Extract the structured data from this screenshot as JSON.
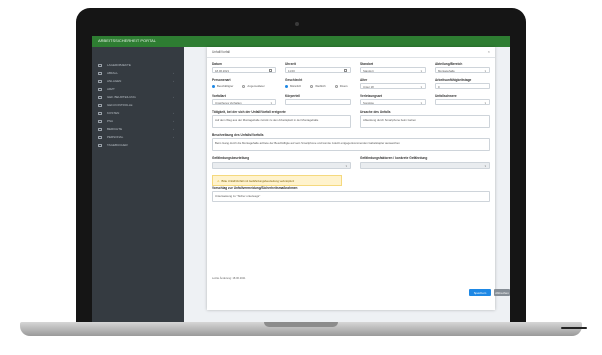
{
  "app": {
    "brand": "ARBEITSSICHERHEIT PORTAL"
  },
  "sidebar": {
    "items": [
      {
        "label": "LAGEROBJEKTE",
        "icon": "box-icon",
        "has_children": false
      },
      {
        "label": "ABFALL",
        "icon": "trash-icon",
        "has_children": true
      },
      {
        "label": "ANLAGEN",
        "icon": "gear-icon",
        "has_children": true
      },
      {
        "label": "ARZT",
        "icon": "medical-icon",
        "has_children": false
      },
      {
        "label": "GEF. BEURTEILUNG",
        "icon": "clipboard-icon",
        "has_children": true
      },
      {
        "label": "GEN.KONTROLLE",
        "icon": "check-icon",
        "has_children": false
      },
      {
        "label": "KOSTEN",
        "icon": "euro-icon",
        "has_children": true
      },
      {
        "label": "PSA",
        "icon": "helmet-icon",
        "has_children": true
      },
      {
        "label": "BERICHTE",
        "icon": "report-icon",
        "has_children": true
      },
      {
        "label": "PERSONAL",
        "icon": "users-icon",
        "has_children": true
      },
      {
        "label": "TAGEBUCHER",
        "icon": "book-icon",
        "has_children": false
      }
    ]
  },
  "modal": {
    "title": "Unfall/Vorfall",
    "close_label": "×",
    "datum": {
      "label": "Datum",
      "value": "18.06.2021"
    },
    "uhrzeit": {
      "label": "Uhrzeit",
      "value": "11:00"
    },
    "standort": {
      "label": "Standort",
      "value": "Standort"
    },
    "abteilung": {
      "label": "Abteilung/Bereich",
      "value": "Montagehalle"
    },
    "personenart": {
      "label": "Personenart",
      "options": [
        "Beschäftigter",
        "Angemeldeter"
      ],
      "selected": "Beschäftigter"
    },
    "geschlecht": {
      "label": "Geschlecht",
      "options": [
        "Männlich",
        "Weiblich",
        "Divers"
      ],
      "selected": "Männlich"
    },
    "alter": {
      "label": "Alter",
      "value": "Unter 18"
    },
    "arbeitsunfaehigkeitstage": {
      "label": "Arbeitsunfähigkeitstage",
      "value": "0"
    },
    "vorfallart": {
      "label": "Vorfallart",
      "value": "Unsicheres Verhalten"
    },
    "koerperteil": {
      "label": "Körperteil",
      "value": ""
    },
    "verletzungsart": {
      "label": "Verletzungsart",
      "value": "Sonstige"
    },
    "unfallschwere": {
      "label": "Unfallschwere",
      "value": ""
    },
    "taetigkeit": {
      "label": "Tätigkeit, bei der sich der Unfall/Vorfall ereignete",
      "value": "Auf dem Weg aus der Montagehalle zurück zu den Arbeitsplatz in der Montagehalle"
    },
    "ursache": {
      "label": "Ursache des Unfalls",
      "value": "Ablenkung durch Smartphone beim Gehen"
    },
    "beschreibung": {
      "label": "Beschreibung des Unfalls/Vorfalls",
      "value": "Beim Gang durch die Montagehalle achtete der Beschäftigte auf sein Smartphone und konnte zuletzt entgegenkommenden Gabelstapler ausweichen"
    },
    "gefaehrdungsbeurteilung": {
      "label": "Gefährdungsbeurteilung",
      "value": "",
      "warning": "Bitte Unfall/Vorfall mit Gefährdungsbeurteilung verknüpfen!"
    },
    "gefaehrdungsfaktoren": {
      "label": "Gefährdungsfaktoren / konkrete Gefährdung",
      "value": ""
    },
    "vorschlag": {
      "label": "Vorschlag zur Unfallvermeidung/Sicherheitsmaßnahmen",
      "value": "Unterweisung zu \"Sicher unterwegs\""
    },
    "erfasst": "Letzte Änderung: 18.06.2021",
    "save_label": "Speichern",
    "cancel_label": "Abbrechen"
  }
}
